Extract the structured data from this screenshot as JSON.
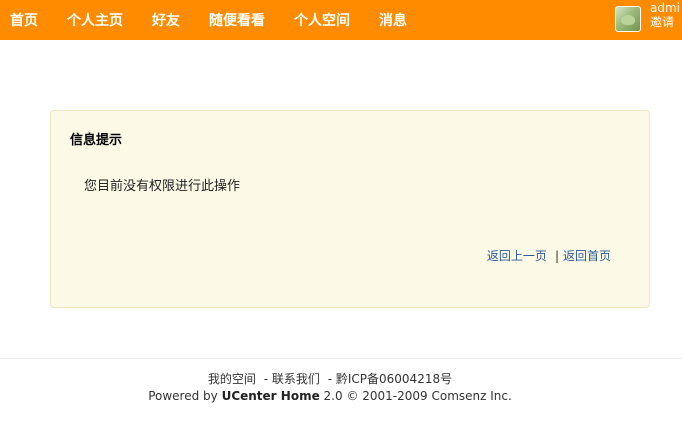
{
  "nav": {
    "items": [
      {
        "label": "首页"
      },
      {
        "label": "个人主页"
      },
      {
        "label": "好友"
      },
      {
        "label": "随便看看"
      },
      {
        "label": "个人空间"
      },
      {
        "label": "消息"
      }
    ]
  },
  "user": {
    "name": "admi",
    "invite_label": "邀请"
  },
  "message": {
    "title": "信息提示",
    "text": "您目前没有权限进行此操作",
    "back_link": "返回上一页",
    "separator": "|",
    "home_link": "返回首页"
  },
  "footer": {
    "links": [
      {
        "label": "我的空间"
      },
      {
        "label": "- 联系我们"
      },
      {
        "label": "- 黔ICP备06004218号"
      }
    ],
    "powered_prefix": "Powered by",
    "product_name": "UCenter Home",
    "version_copyright": "2.0 © 2001-2009 Comsenz Inc."
  },
  "colors": {
    "topbar": "#ff8c00",
    "message_bg": "#fcfae6",
    "link": "#2b5a94"
  }
}
